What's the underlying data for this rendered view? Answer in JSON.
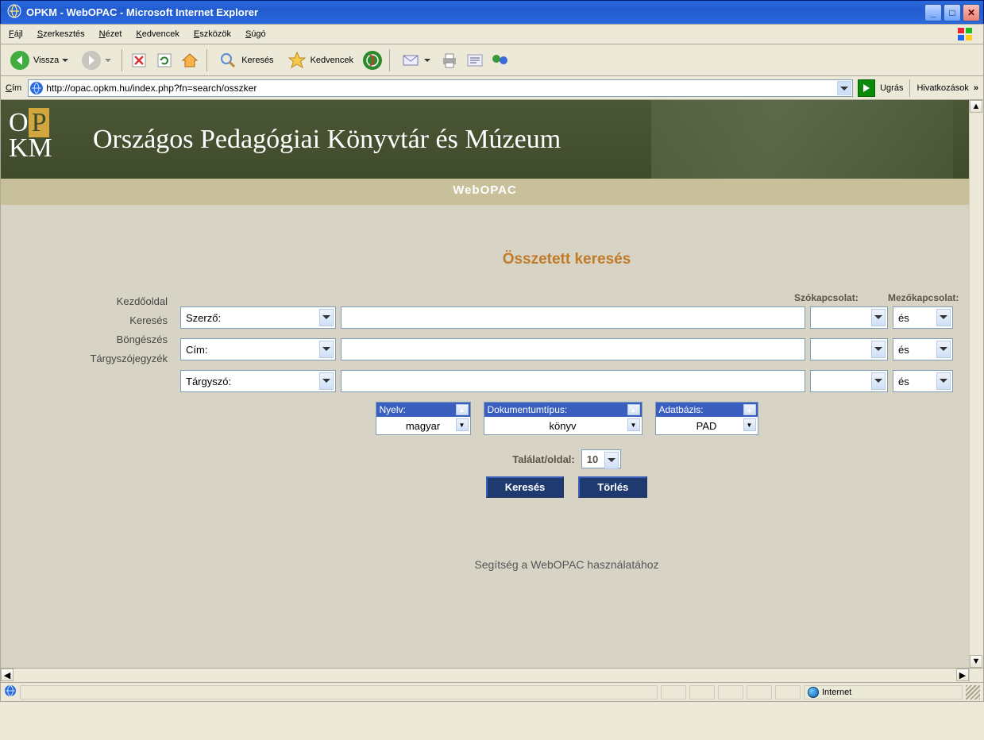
{
  "window": {
    "title": "OPKM - WebOPAC - Microsoft Internet Explorer"
  },
  "menubar": {
    "items": [
      "Fájl",
      "Szerkesztés",
      "Nézet",
      "Kedvencek",
      "Eszközök",
      "Súgó"
    ]
  },
  "toolbar": {
    "back": "Vissza",
    "search": "Keresés",
    "favorites": "Kedvencek"
  },
  "addressbar": {
    "label": "Cím",
    "url": "http://opac.opkm.hu/index.php?fn=search/osszker",
    "go": "Ugrás",
    "links": "Hivatkozások"
  },
  "banner": {
    "title": "Országos Pedagógiai Könyvtár és Múzeum"
  },
  "subheader": "WebOPAC",
  "sidebar": {
    "items": [
      "Kezdőoldal",
      "Keresés",
      "Böngészés",
      "Tárgyszójegyzék"
    ]
  },
  "form": {
    "title": "Összetett keresés",
    "labels": {
      "word_rel": "Szókapcsolat:",
      "field_rel": "Mezőkapcsolat:"
    },
    "rows": [
      {
        "field": "Szerző:",
        "rel": "",
        "op": "és"
      },
      {
        "field": "Cím:",
        "rel": "",
        "op": "és"
      },
      {
        "field": "Tárgyszó:",
        "rel": "",
        "op": "és"
      }
    ],
    "filters": {
      "lang": {
        "label": "Nyelv:",
        "value": "magyar"
      },
      "type": {
        "label": "Dokumentumtípus:",
        "value": "könyv"
      },
      "db": {
        "label": "Adatbázis:",
        "value": "PAD"
      }
    },
    "perpage": {
      "label": "Találat/oldal:",
      "value": "10"
    },
    "buttons": {
      "search": "Keresés",
      "clear": "Törlés"
    },
    "help": "Segítség a WebOPAC használatához"
  },
  "statusbar": {
    "zone": "Internet"
  }
}
